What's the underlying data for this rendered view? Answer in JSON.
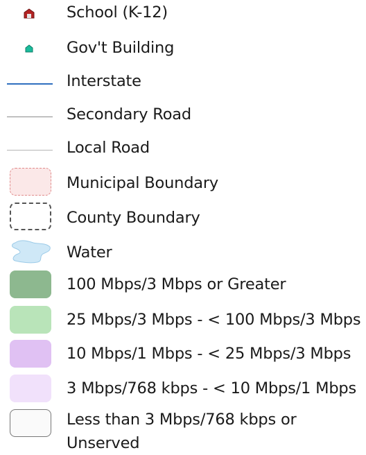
{
  "legend": {
    "school": {
      "label": "School (K-12)",
      "icon": "school-icon",
      "color": "#b22222"
    },
    "gov_building": {
      "label": "Gov't Building",
      "icon": "gov-building-icon",
      "color": "#1abc9c"
    },
    "interstate": {
      "label": "Interstate",
      "color": "#2f6fbf"
    },
    "secondary_road": {
      "label": "Secondary Road",
      "color": "#8c8c8c"
    },
    "local_road": {
      "label": "Local Road",
      "color": "#b4b4b4"
    },
    "municipal_boundary": {
      "label": "Municipal Boundary",
      "fill": "#fbe8e8",
      "border": "#e08a8a"
    },
    "county_boundary": {
      "label": "County Boundary",
      "fill": "#ffffff",
      "border": "#555555"
    },
    "water": {
      "label": "Water",
      "fill": "#cfe8f7",
      "border": "#9ccbe8"
    },
    "speed_100": {
      "label": "100 Mbps/3 Mbps or Greater",
      "fill": "#8db88f"
    },
    "speed_25": {
      "label": "25 Mbps/3 Mbps - < 100 Mbps/3 Mbps",
      "fill": "#b9e4b9"
    },
    "speed_10": {
      "label": "10 Mbps/1 Mbps - < 25 Mbps/3 Mbps",
      "fill": "#e0c1f3"
    },
    "speed_3": {
      "label": "3 Mbps/768 kbps - < 10 Mbps/1 Mbps",
      "fill": "#f1e1fb"
    },
    "unserved": {
      "label": "Less than 3 Mbps/768 kbps or Unserved",
      "fill": "#fafafa",
      "border": "#777777"
    }
  }
}
